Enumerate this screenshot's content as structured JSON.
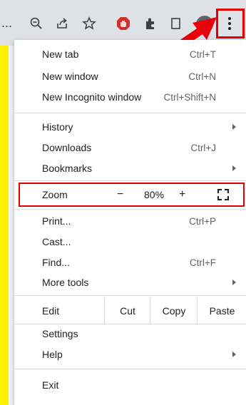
{
  "toolbar": {
    "ellipsis": "...",
    "icons": [
      "zoom-out-icon",
      "share-icon",
      "bookmark-star-icon",
      "adblock-icon",
      "extensions-icon",
      "reading-list-icon",
      "profile-avatar",
      "more-options-icon"
    ]
  },
  "menu": {
    "new_tab": {
      "label": "New tab",
      "shortcut": "Ctrl+T"
    },
    "new_window": {
      "label": "New window",
      "shortcut": "Ctrl+N"
    },
    "incognito": {
      "label": "New Incognito window",
      "shortcut": "Ctrl+Shift+N"
    },
    "history": {
      "label": "History"
    },
    "downloads": {
      "label": "Downloads",
      "shortcut": "Ctrl+J"
    },
    "bookmarks": {
      "label": "Bookmarks"
    },
    "zoom": {
      "label": "Zoom",
      "minus": "−",
      "value": "80%",
      "plus": "+"
    },
    "print": {
      "label": "Print...",
      "shortcut": "Ctrl+P"
    },
    "cast": {
      "label": "Cast..."
    },
    "find": {
      "label": "Find...",
      "shortcut": "Ctrl+F"
    },
    "more_tools": {
      "label": "More tools"
    },
    "edit": {
      "label": "Edit",
      "cut": "Cut",
      "copy": "Copy",
      "paste": "Paste"
    },
    "settings": {
      "label": "Settings"
    },
    "help": {
      "label": "Help"
    },
    "exit": {
      "label": "Exit"
    }
  },
  "colors": {
    "highlight": "#e00000",
    "background": "#ffef00"
  }
}
